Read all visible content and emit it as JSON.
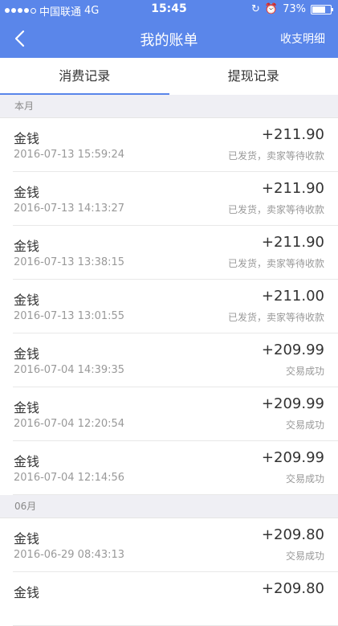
{
  "status_bar": {
    "carrier": "中国联通",
    "network": "4G",
    "time": "15:45",
    "battery": "73%",
    "battery_level": 0.73
  },
  "nav": {
    "title": "我的账单",
    "right_label": "收支明细"
  },
  "tabs": [
    {
      "label": "消费记录",
      "active": true
    },
    {
      "label": "提现记录",
      "active": false
    }
  ],
  "sections": [
    {
      "header": "本月",
      "rows": [
        {
          "name": "金钱",
          "date": "2016-07-13 15:59:24",
          "amount": "+211.90",
          "status": "已发货，卖家等待收款"
        },
        {
          "name": "金钱",
          "date": "2016-07-13 14:13:27",
          "amount": "+211.90",
          "status": "已发货，卖家等待收款"
        },
        {
          "name": "金钱",
          "date": "2016-07-13 13:38:15",
          "amount": "+211.90",
          "status": "已发货，卖家等待收款"
        },
        {
          "name": "金钱",
          "date": "2016-07-13 13:01:55",
          "amount": "+211.00",
          "status": "已发货，卖家等待收款"
        },
        {
          "name": "金钱",
          "date": "2016-07-04 14:39:35",
          "amount": "+209.99",
          "status": "交易成功"
        },
        {
          "name": "金钱",
          "date": "2016-07-04 12:20:54",
          "amount": "+209.99",
          "status": "交易成功"
        },
        {
          "name": "金钱",
          "date": "2016-07-04 12:14:56",
          "amount": "+209.99",
          "status": "交易成功"
        }
      ]
    },
    {
      "header": "06月",
      "rows": [
        {
          "name": "金钱",
          "date": "2016-06-29 08:43:13",
          "amount": "+209.80",
          "status": "交易成功"
        },
        {
          "name": "金钱",
          "date": "",
          "amount": "+209.80",
          "status": ""
        }
      ]
    }
  ]
}
